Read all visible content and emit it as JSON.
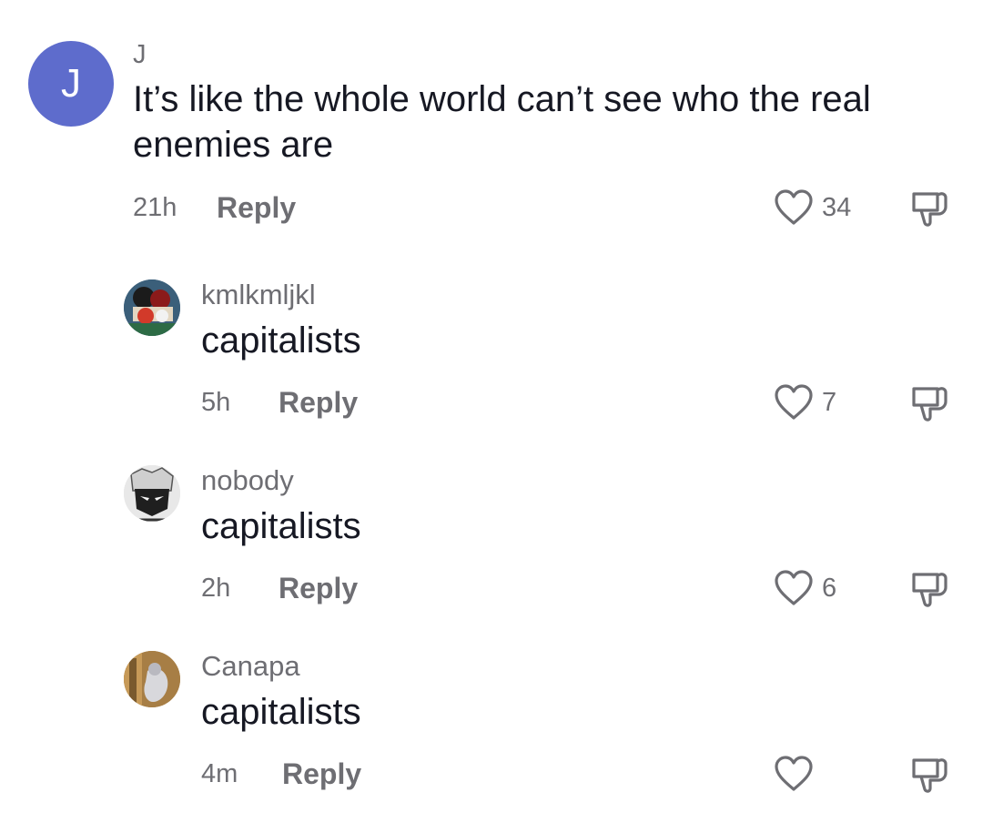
{
  "comments": [
    {
      "avatar_letter": "J",
      "username": "J",
      "text": "It’s like the whole world can’t see who the real enemies are",
      "time": "21h",
      "reply_label": "Reply",
      "likes": "34",
      "avatar_icon": "letter-avatar"
    },
    {
      "username": "kmlkmljkl",
      "text": "capitalists",
      "time": "5h",
      "reply_label": "Reply",
      "likes": "7",
      "avatar_icon": "anime-characters-avatar"
    },
    {
      "username": "nobody",
      "text": "capitalists",
      "time": "2h",
      "reply_label": "Reply",
      "likes": "6",
      "avatar_icon": "manga-character-avatar"
    },
    {
      "username": "Canapa",
      "text": "capitalists",
      "time": "4m",
      "reply_label": "Reply",
      "likes": "",
      "avatar_icon": "photo-avatar"
    }
  ],
  "colors": {
    "avatar_bg": "#5e6ccc",
    "secondary_text": "#6e6e73",
    "primary_text": "#161823"
  }
}
